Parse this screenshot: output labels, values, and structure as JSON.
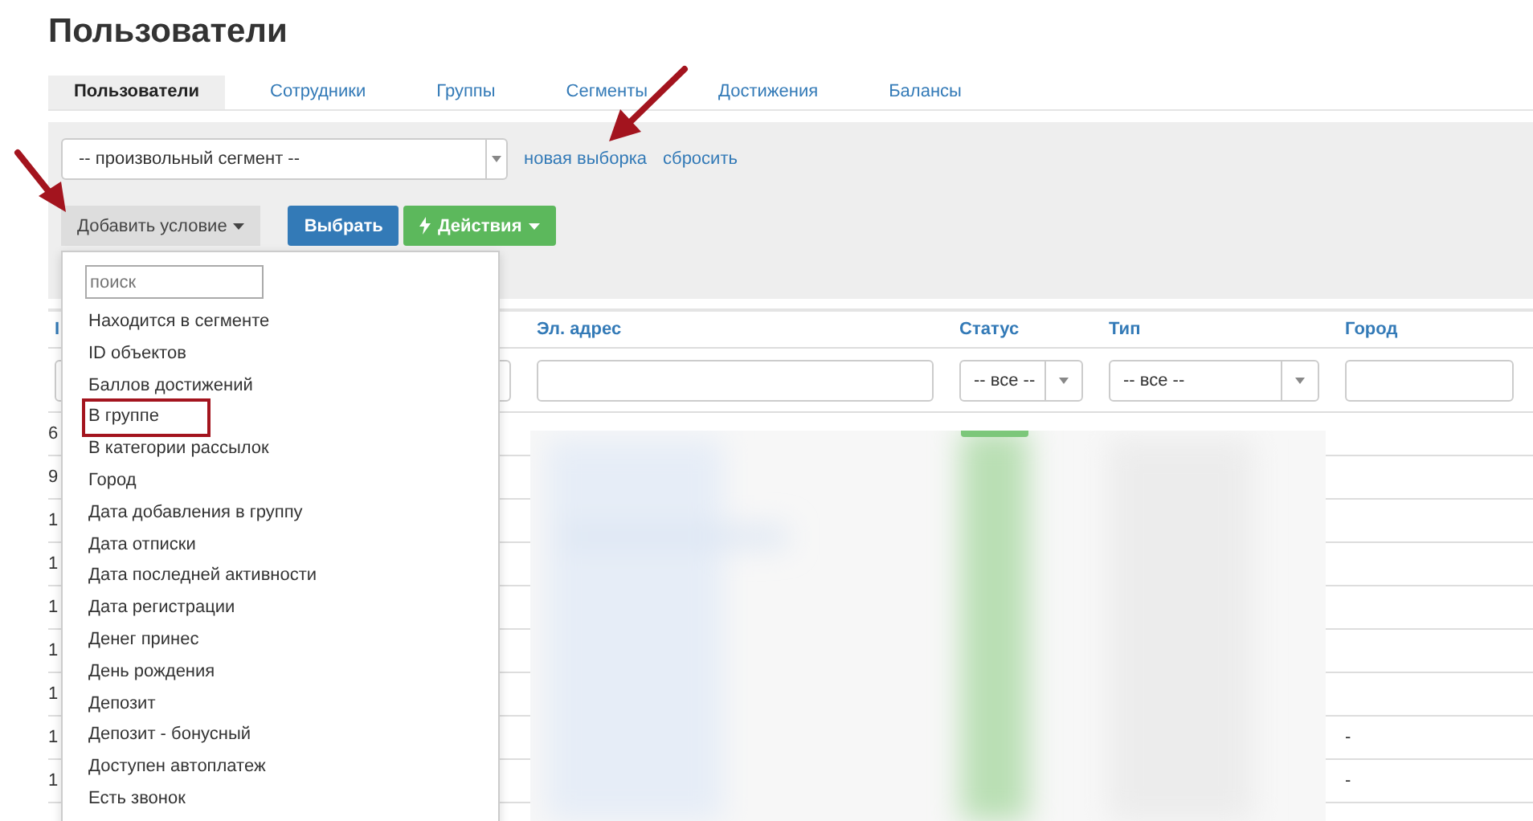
{
  "page": {
    "title": "Пользователи"
  },
  "tabs": [
    {
      "label": "Пользователи",
      "selected": true
    },
    {
      "label": "Сотрудники",
      "selected": false
    },
    {
      "label": "Группы",
      "selected": false
    },
    {
      "label": "Сегменты",
      "selected": false
    },
    {
      "label": "Достижения",
      "selected": false
    },
    {
      "label": "Балансы",
      "selected": false
    }
  ],
  "filter_panel": {
    "segment_select": "-- произвольный сегмент --",
    "links": [
      "новая выборка",
      "сбросить"
    ],
    "buttons": [
      {
        "label": "Добавить условие",
        "kind": "dropdown"
      },
      {
        "label": "Выбрать",
        "kind": "primary"
      },
      {
        "label": "Действия",
        "kind": "actions"
      }
    ]
  },
  "condition_menu": {
    "search": {
      "placeholder": "поиск"
    },
    "items": [
      {
        "label": "Находится в сегменте",
        "highlighted": false
      },
      {
        "label": "ID объектов",
        "highlighted": false
      },
      {
        "label": "Баллов достижений",
        "highlighted": false
      },
      {
        "label": "В группе",
        "highlighted": true
      },
      {
        "label": "В категории рассылок",
        "highlighted": false
      },
      {
        "label": "Город",
        "highlighted": false
      },
      {
        "label": "Дата добавления в группу",
        "highlighted": false
      },
      {
        "label": "Дата отписки",
        "highlighted": false
      },
      {
        "label": "Дата последней активности",
        "highlighted": false
      },
      {
        "label": "Дата регистрации",
        "highlighted": false
      },
      {
        "label": "Денег принес",
        "highlighted": false
      },
      {
        "label": "День рождения",
        "highlighted": false
      },
      {
        "label": "Депозит",
        "highlighted": false
      },
      {
        "label": "Депозит - бонусный",
        "highlighted": false
      },
      {
        "label": "Доступен автоплатеж",
        "highlighted": false
      },
      {
        "label": "Есть звонок",
        "highlighted": false
      }
    ]
  },
  "table": {
    "columns": [
      {
        "label": "I"
      },
      {
        "label": "Эл. адрес"
      },
      {
        "label": "Статус"
      },
      {
        "label": "Тип"
      },
      {
        "label": "Город"
      }
    ],
    "filters": [
      {
        "kind": "text"
      },
      {
        "kind": "text"
      },
      {
        "kind": "select",
        "value": "-- все --"
      },
      {
        "kind": "select",
        "value": "-- все --"
      },
      {
        "kind": "text"
      }
    ],
    "rows": [
      {
        "column_1": "6"
      },
      {
        "column_1": "9"
      },
      {
        "column_1": "1"
      },
      {
        "column_1": "1"
      },
      {
        "column_1": "1"
      },
      {
        "column_1": "1"
      },
      {
        "column_1": "1"
      },
      {
        "column_1": "1",
        "city": "-"
      },
      {
        "column_1": "1",
        "city": "-"
      }
    ]
  }
}
